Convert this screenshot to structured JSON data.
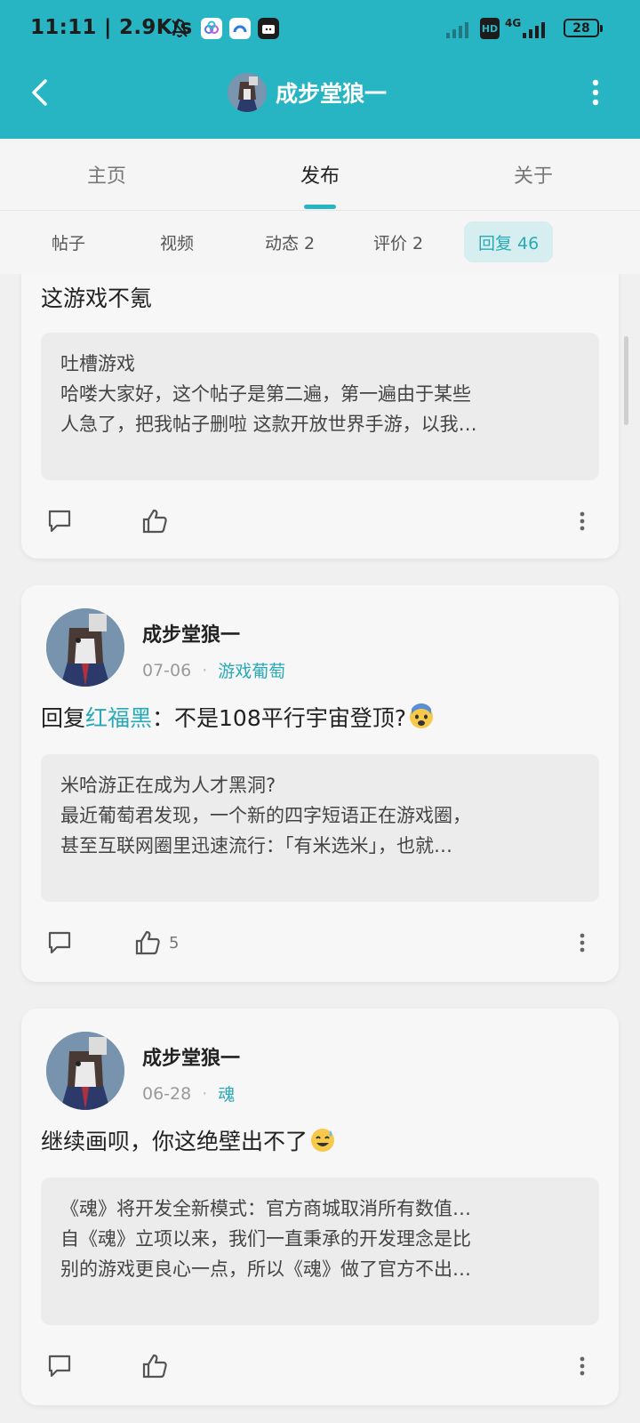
{
  "status_bar": {
    "time": "11:11",
    "speed": "2.9K/s",
    "network": "4G",
    "hd": "HD",
    "battery": "28"
  },
  "header": {
    "title": "成步堂狼一"
  },
  "main_tabs": [
    "主页",
    "发布",
    "关于"
  ],
  "sub_tabs": [
    "帖子",
    "视频",
    "动态 2",
    "评价 2",
    "回复 46"
  ],
  "posts": [
    {
      "reply": "这游戏不氪",
      "quote_lines": [
        "吐槽游戏",
        "哈喽大家好，这个帖子是第二遍，第一遍由于某些",
        "人急了，把我帖子删啦 这款开放世界手游，以我…"
      ],
      "likes": ""
    },
    {
      "author": "成步堂狼一",
      "date": "07-06",
      "topic": "游戏葡萄",
      "reply_prefix": "回复",
      "mention": "红福黑",
      "reply_rest": "：不是108平行宇宙登顶?",
      "quote_lines": [
        "米哈游正在成为人才黑洞?",
        "最近葡萄君发现，一个新的四字短语正在游戏圈，",
        "甚至互联网圈里迅速流行：「有米选米」，也就…"
      ],
      "likes": "5"
    },
    {
      "author": "成步堂狼一",
      "date": "06-28",
      "topic": "魂",
      "reply": "继续画呗，你这绝壁出不了",
      "quote_lines": [
        "《魂》将开发全新模式：官方商城取消所有数值…",
        "自《魂》立项以来，我们一直秉承的开发理念是比",
        "别的游戏更良心一点，所以《魂》做了官方不出…"
      ],
      "likes": ""
    }
  ],
  "colors": {
    "accent": "#28b5c3",
    "link": "#28a9b7"
  }
}
